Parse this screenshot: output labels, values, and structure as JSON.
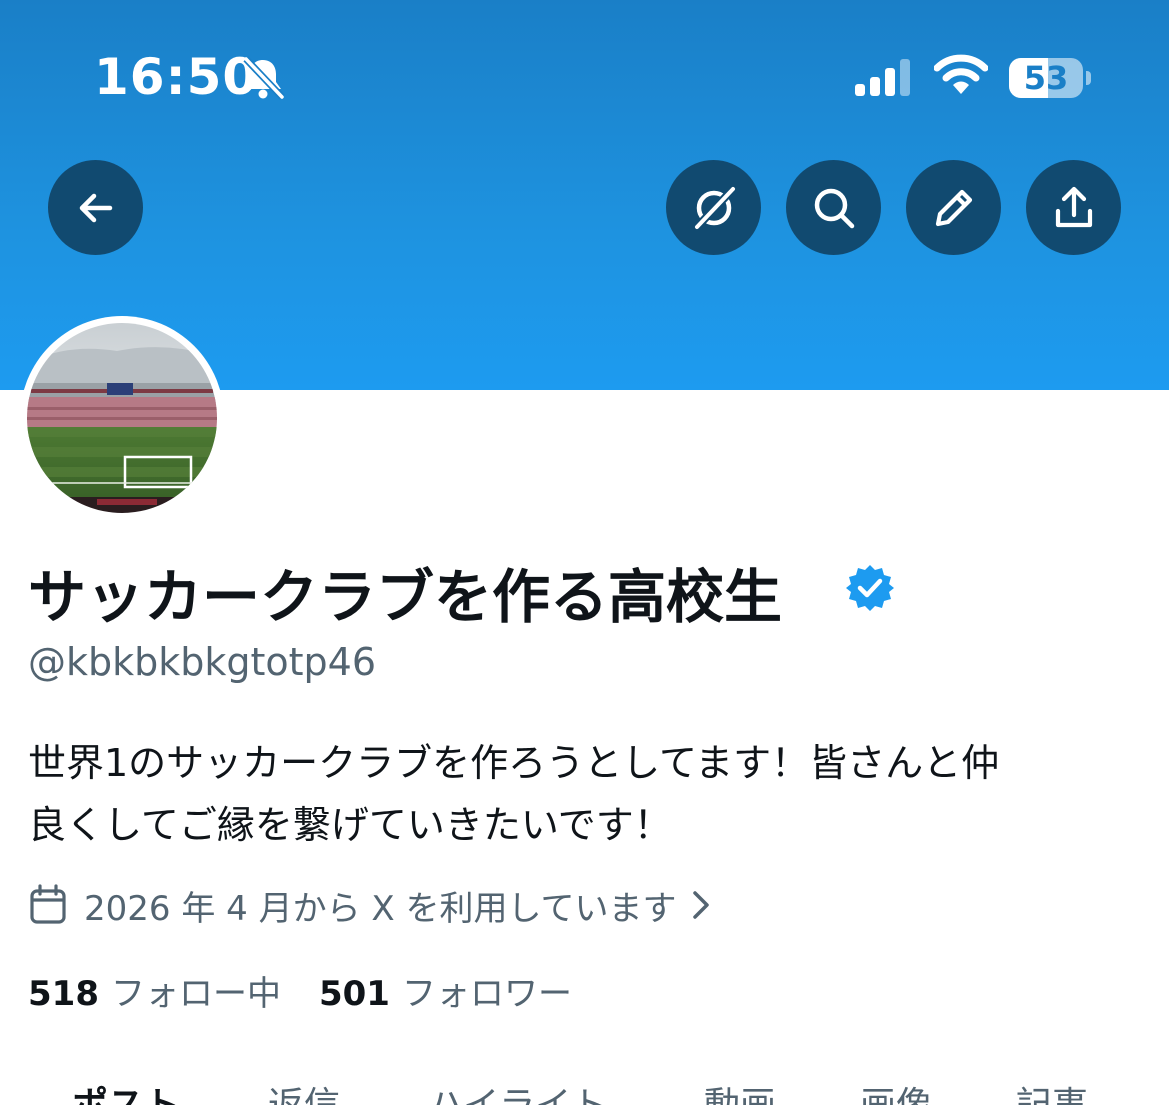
{
  "status_bar": {
    "time": "16:50",
    "battery": "53",
    "icons": [
      "bell-muted-icon",
      "signal-icon",
      "wifi-icon",
      "battery-icon"
    ]
  },
  "header": {
    "buttons": [
      "back-arrow-icon",
      "grok-icon",
      "search-icon",
      "pencil-icon",
      "share-icon"
    ]
  },
  "profile": {
    "name": "サッカークラブを作る高校生",
    "handle": "@kbkbkbkgtotp46",
    "bio_line1": "世界1のサッカークラブを作ろうとしてます！皆さんと仲",
    "bio_line2": "良くしてご縁を繋げていきたいです！",
    "joined": "2026 年 4 月から X を利用しています",
    "following_count": "518",
    "following_label": "フォロー中",
    "followers_count": "501",
    "followers_label": "フォロワー"
  },
  "tabs": [
    {
      "label": "ポスト",
      "active": true
    },
    {
      "label": "返信",
      "active": false
    },
    {
      "label": "ハイライト",
      "active": false
    },
    {
      "label": "動画",
      "active": false
    },
    {
      "label": "画像",
      "active": false
    },
    {
      "label": "記事",
      "active": false
    }
  ],
  "colors": {
    "banner": "#1d9bf0",
    "button_bg": "#114a70",
    "verified": "#1d9bf0",
    "secondary_text": "#536471"
  }
}
